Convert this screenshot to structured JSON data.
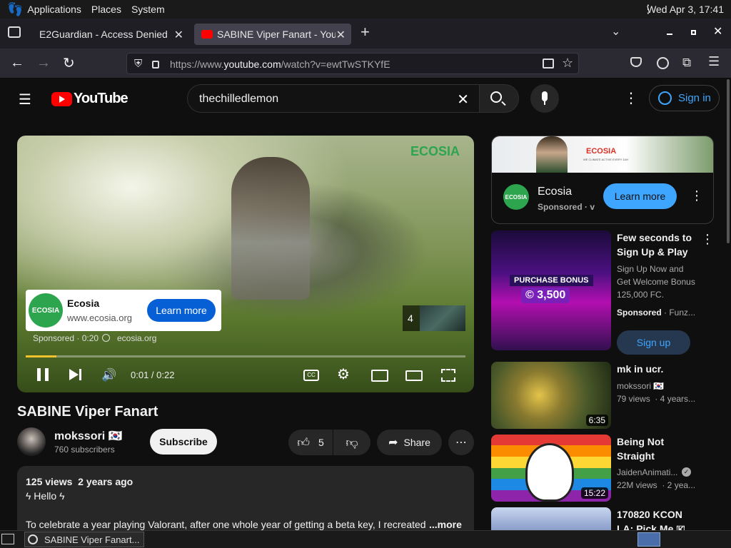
{
  "panel": {
    "applications": "Applications",
    "places": "Places",
    "system": "System",
    "clock": "Wed Apr  3, 17:41"
  },
  "tabs": [
    {
      "title": "E2Guardian - Access Denied"
    },
    {
      "title": "SABINE Viper Fanart - YouTube"
    }
  ],
  "nav": {
    "url_prefix": "https://www.",
    "url_domain": "youtube.com",
    "url_path": "/watch?v=ewtTwSTKYfE"
  },
  "yt": {
    "logo_text": "YouTube",
    "search_value": "thechilledlemon",
    "signin": "Sign in",
    "player": {
      "watermark": "ECOSIA",
      "ad_name": "Ecosia",
      "ad_url": "www.ecosia.org",
      "ad_button": "Learn more",
      "sponsored": "Sponsored · 0:20",
      "ad_domain": "ecosia.org",
      "skip_count": "4",
      "time": "0:01 / 0:22",
      "progress": 0.07
    },
    "video": {
      "title": "SABINE Viper Fanart",
      "channel": "mokssori 🇰🇷",
      "subscribers": "760 subscribers",
      "subscribe": "Subscribe",
      "likes": "5",
      "share": "Share"
    },
    "description": {
      "meta": "125 views  2 years ago",
      "line1": "ϟ Hello ϟ",
      "line2": "To celebrate a year playing Valorant, after one whole year of getting a beta key, I recreated t",
      "more": "...more"
    },
    "side_ad": {
      "banner_logo": "ECOSIA",
      "banner_tag": "WE CLIMATE ACTIVE EVERY DAY",
      "name": "Ecosia",
      "sponsored": "Sponsored · v",
      "button": "Learn more"
    },
    "recs": [
      {
        "title1": "Few seconds to",
        "title2": "Sign Up & Play",
        "sub1": "Sign Up Now and",
        "sub2": "Get Welcome Bonus",
        "sub3": "125,000 FC.",
        "sponsored": "Sponsored",
        "sponsor": "· Funz...",
        "button": "Sign up",
        "thumb_text1": "PURCHASE BONUS",
        "thumb_text2": "© 3,500"
      },
      {
        "title1": "mk in ucr.",
        "channel": "mokssori 🇰🇷",
        "meta": "79 views  · 4 years...",
        "duration": "6:35"
      },
      {
        "title1": "Being Not",
        "title2": "Straight",
        "channel": "JaidenAnimati...",
        "meta": "22M views  · 2 yea...",
        "duration": "15:22"
      },
      {
        "title1": "170820 KCON",
        "title2": "LA: Pick Me 🇰"
      }
    ]
  },
  "taskbar": {
    "window": "SABINE Viper Fanart..."
  },
  "colors": {
    "accent_blue": "#3ea6ff",
    "button_blue": "#065fd4",
    "youtube_red": "#ff0000",
    "ecosia_green": "#2da44e"
  }
}
